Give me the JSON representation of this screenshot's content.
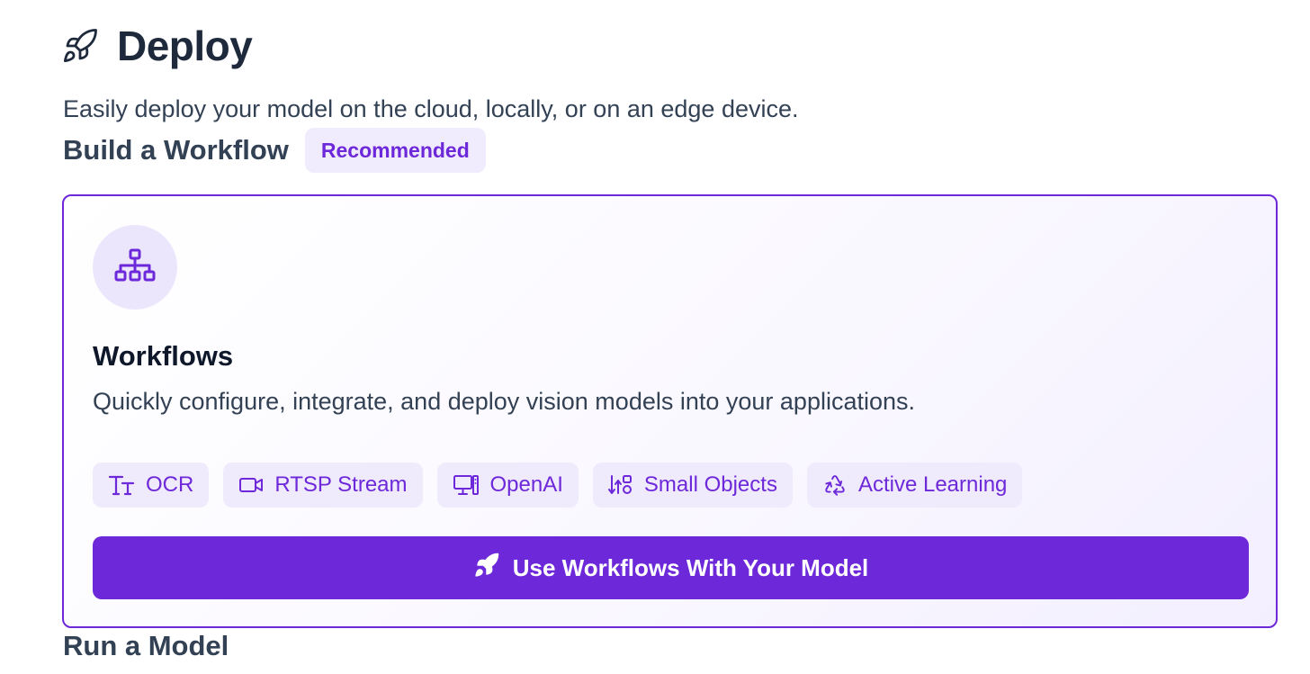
{
  "header": {
    "icon": "rocket-icon",
    "title": "Deploy",
    "subtitle": "Easily deploy your model on the cloud, locally, or on an edge device."
  },
  "workflow_section": {
    "title": "Build a Workflow",
    "badge": "Recommended"
  },
  "card": {
    "icon": "sitemap-icon",
    "title": "Workflows",
    "description": "Quickly configure, integrate, and deploy vision models into your applications.",
    "tags": [
      {
        "label": "OCR",
        "icon": "text-size-icon"
      },
      {
        "label": "RTSP Stream",
        "icon": "video-camera-icon"
      },
      {
        "label": "OpenAI",
        "icon": "computer-icon"
      },
      {
        "label": "Small Objects",
        "icon": "sort-shapes-icon"
      },
      {
        "label": "Active Learning",
        "icon": "recycle-icon"
      }
    ],
    "cta_label": "Use Workflows With Your Model",
    "cta_icon": "rocket-icon"
  },
  "next_section": {
    "title": "Run a Model"
  },
  "colors": {
    "accent": "#6d28d9",
    "accent_light": "#efeafc",
    "text_dark": "#1e293b",
    "text_body": "#334155"
  }
}
